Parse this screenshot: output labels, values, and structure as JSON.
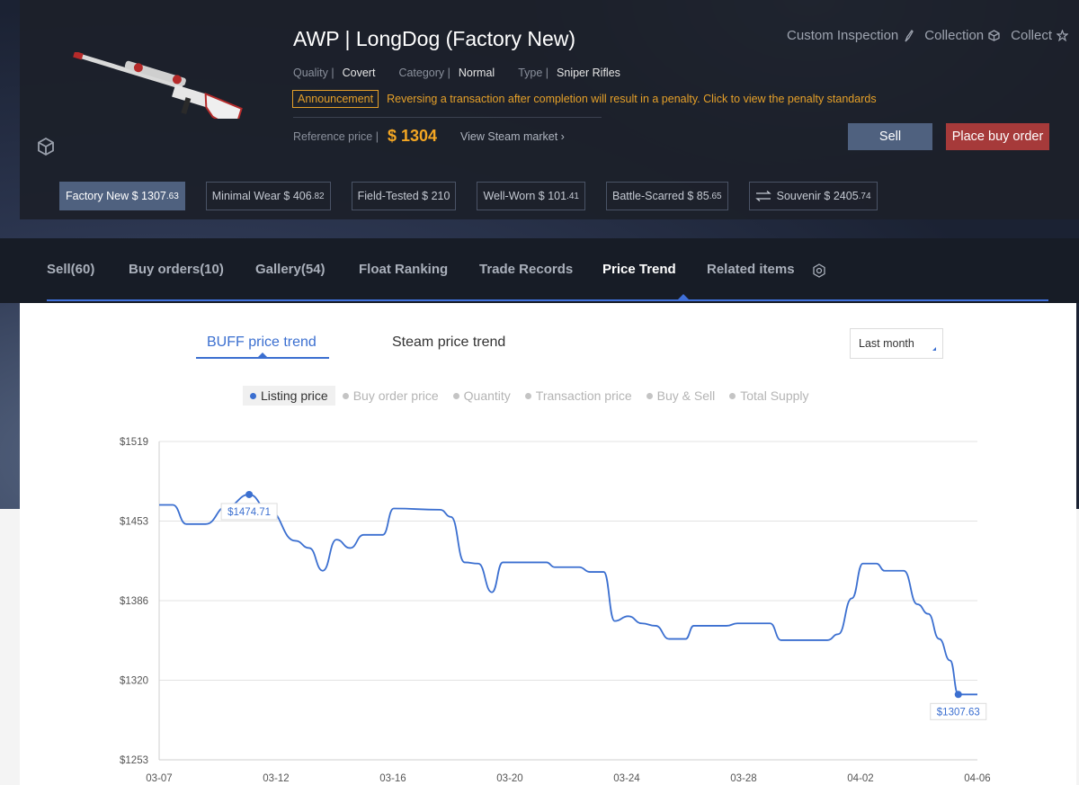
{
  "item": {
    "title": "AWP | LongDog (Factory New)",
    "quality_label": "Quality |",
    "quality": "Covert",
    "category_label": "Category |",
    "category": "Normal",
    "type_label": "Type |",
    "type": "Sniper Rifles",
    "announcement_badge": "Announcement",
    "announcement_text": "Reversing a transaction after completion will result in a penalty. Click to view the penalty standards",
    "reference_label": "Reference price |",
    "reference_price": "$ 1304",
    "steam_link": "View Steam market ›"
  },
  "header_actions": [
    {
      "label": "Custom Inspection",
      "icon": "brush-icon"
    },
    {
      "label": "Collection",
      "icon": "box-icon"
    },
    {
      "label": "Collect",
      "icon": "star-icon"
    }
  ],
  "buttons": {
    "sell": "Sell",
    "buy_order": "Place buy order"
  },
  "wears": [
    {
      "main": "Factory New $ 1307",
      "dec": ".63",
      "active": true
    },
    {
      "main": "Minimal Wear $ 406",
      "dec": ".82",
      "active": false
    },
    {
      "main": "Field-Tested $ 210",
      "dec": "",
      "active": false
    },
    {
      "main": "Well-Worn $ 101",
      "dec": ".41",
      "active": false
    },
    {
      "main": "Battle-Scarred $ 85",
      "dec": ".65",
      "active": false
    },
    {
      "main": "Souvenir $ 2405",
      "dec": ".74",
      "active": false
    }
  ],
  "tabs": [
    {
      "label": "Sell(60)"
    },
    {
      "label": "Buy orders(10)"
    },
    {
      "label": "Gallery(54)"
    },
    {
      "label": "Float Ranking"
    },
    {
      "label": "Trade Records"
    },
    {
      "label": "Price Trend",
      "active": true
    },
    {
      "label": "Related items"
    }
  ],
  "trend_tabs": {
    "buff": "BUFF price trend",
    "steam": "Steam price trend"
  },
  "range": "Last month",
  "legend": [
    {
      "label": "Listing price",
      "active": true
    },
    {
      "label": "Buy order price",
      "active": false
    },
    {
      "label": "Quantity",
      "active": false
    },
    {
      "label": "Transaction price",
      "active": false
    },
    {
      "label": "Buy & Sell",
      "active": false
    },
    {
      "label": "Total Supply",
      "active": false
    }
  ],
  "colors": {
    "accent": "#3b6fd0",
    "price": "#f3a623",
    "announce": "#e5a029",
    "buy_button": "#a63a3a",
    "sell_button": "#4f617f"
  },
  "chart_data": {
    "type": "line",
    "x_ticks": [
      "03-07",
      "03-12",
      "03-16",
      "03-20",
      "03-24",
      "03-28",
      "04-02",
      "04-06"
    ],
    "y_ticks": [
      "$1519",
      "$1453",
      "$1386",
      "$1320",
      "$1253"
    ],
    "ylim": [
      1253,
      1519
    ],
    "xlim": [
      0,
      30
    ],
    "grid": true,
    "series": [
      {
        "name": "Listing price",
        "points": [
          [
            0,
            1466
          ],
          [
            0.5,
            1466
          ],
          [
            1,
            1450
          ],
          [
            1.7,
            1450
          ],
          [
            2.5,
            1465
          ],
          [
            3.3,
            1474.71
          ],
          [
            4,
            1462
          ],
          [
            5,
            1436
          ],
          [
            5.5,
            1430
          ],
          [
            6,
            1411
          ],
          [
            6.5,
            1437
          ],
          [
            7,
            1430
          ],
          [
            7.5,
            1441
          ],
          [
            8.2,
            1441
          ],
          [
            8.6,
            1463
          ],
          [
            10.3,
            1462
          ],
          [
            10.7,
            1456
          ],
          [
            11.2,
            1418
          ],
          [
            11.7,
            1417
          ],
          [
            12.2,
            1393
          ],
          [
            12.6,
            1418
          ],
          [
            14.2,
            1418
          ],
          [
            14.5,
            1414
          ],
          [
            15.4,
            1414
          ],
          [
            15.8,
            1410
          ],
          [
            16.3,
            1410
          ],
          [
            16.7,
            1369
          ],
          [
            17.2,
            1373
          ],
          [
            17.7,
            1367
          ],
          [
            18.2,
            1365
          ],
          [
            18.7,
            1354
          ],
          [
            19.3,
            1354
          ],
          [
            19.6,
            1365
          ],
          [
            20.8,
            1365
          ],
          [
            21.2,
            1367
          ],
          [
            22.4,
            1367
          ],
          [
            22.8,
            1353
          ],
          [
            24.5,
            1353
          ],
          [
            24.9,
            1358
          ],
          [
            25.4,
            1388
          ],
          [
            25.8,
            1417
          ],
          [
            26.3,
            1417
          ],
          [
            26.6,
            1411
          ],
          [
            27.3,
            1411
          ],
          [
            27.8,
            1383
          ],
          [
            28.2,
            1375
          ],
          [
            28.6,
            1354
          ],
          [
            29,
            1336
          ],
          [
            29.3,
            1307.63
          ],
          [
            30,
            1307.63
          ]
        ]
      }
    ],
    "annotations": [
      {
        "label": "$1474.71",
        "x": 3.3,
        "y": 1474.71
      },
      {
        "label": "$1307.63",
        "x": 29.3,
        "y": 1307.63
      }
    ]
  }
}
